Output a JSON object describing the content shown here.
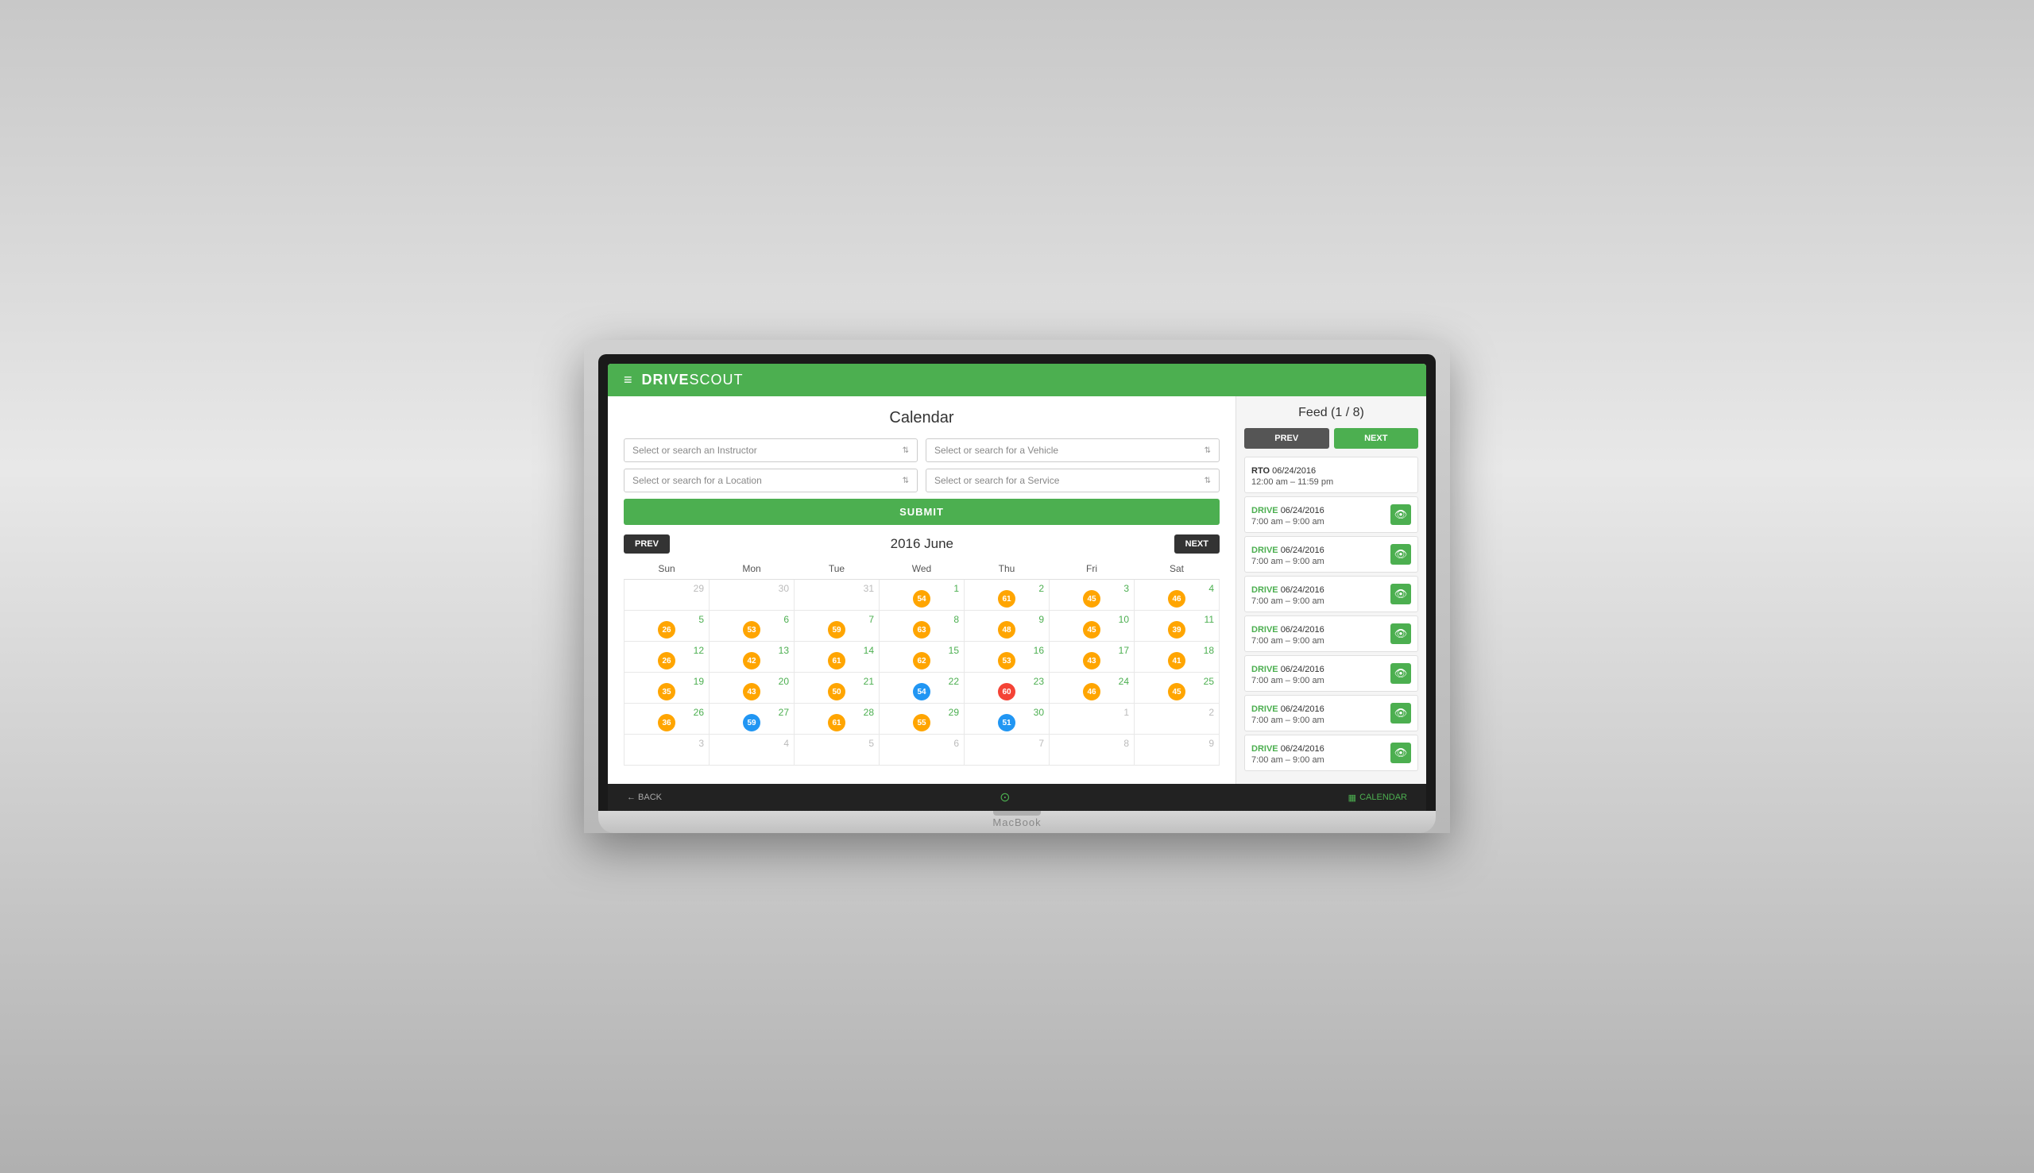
{
  "app": {
    "brand": "DRIVE",
    "brand_scout": "SCOUT",
    "laptop_brand": "MacBook"
  },
  "header": {
    "hamburger": "≡",
    "title": "Calendar",
    "feed_title": "Feed (1 / 8)"
  },
  "filters": {
    "instructor_placeholder": "Select or search an Instructor",
    "vehicle_placeholder": "Select or search for a Vehicle",
    "location_placeholder": "Select or search for a Location",
    "service_placeholder": "Select or search for a Service",
    "submit_label": "SUBMIT"
  },
  "calendar": {
    "prev_label": "PREV",
    "next_label": "NEXT",
    "month_title": "2016 June",
    "weekdays": [
      "Sun",
      "Mon",
      "Tue",
      "Wed",
      "Thu",
      "Fri",
      "Sat"
    ],
    "weeks": [
      [
        {
          "day": "29",
          "other": true,
          "badge": null
        },
        {
          "day": "30",
          "other": true,
          "badge": null
        },
        {
          "day": "31",
          "other": true,
          "badge": null
        },
        {
          "day": "1",
          "other": false,
          "badge": {
            "val": "54",
            "color": "yellow"
          }
        },
        {
          "day": "2",
          "other": false,
          "badge": {
            "val": "61",
            "color": "yellow"
          }
        },
        {
          "day": "3",
          "other": false,
          "badge": {
            "val": "45",
            "color": "yellow"
          }
        },
        {
          "day": "4",
          "other": false,
          "badge": {
            "val": "46",
            "color": "yellow"
          }
        }
      ],
      [
        {
          "day": "5",
          "other": false,
          "badge": {
            "val": "26",
            "color": "yellow"
          }
        },
        {
          "day": "6",
          "other": false,
          "badge": {
            "val": "53",
            "color": "yellow"
          }
        },
        {
          "day": "7",
          "other": false,
          "badge": {
            "val": "59",
            "color": "yellow"
          }
        },
        {
          "day": "8",
          "other": false,
          "badge": {
            "val": "63",
            "color": "yellow"
          }
        },
        {
          "day": "9",
          "other": false,
          "badge": {
            "val": "48",
            "color": "yellow"
          }
        },
        {
          "day": "10",
          "other": false,
          "badge": {
            "val": "45",
            "color": "yellow"
          }
        },
        {
          "day": "11",
          "other": false,
          "badge": {
            "val": "39",
            "color": "yellow"
          }
        }
      ],
      [
        {
          "day": "12",
          "other": false,
          "badge": {
            "val": "26",
            "color": "yellow"
          }
        },
        {
          "day": "13",
          "other": false,
          "badge": {
            "val": "42",
            "color": "yellow"
          }
        },
        {
          "day": "14",
          "other": false,
          "badge": {
            "val": "61",
            "color": "yellow"
          }
        },
        {
          "day": "15",
          "other": false,
          "badge": {
            "val": "62",
            "color": "yellow"
          }
        },
        {
          "day": "16",
          "other": false,
          "badge": {
            "val": "53",
            "color": "yellow"
          }
        },
        {
          "day": "17",
          "other": false,
          "badge": {
            "val": "43",
            "color": "yellow"
          }
        },
        {
          "day": "18",
          "other": false,
          "badge": {
            "val": "41",
            "color": "yellow"
          }
        }
      ],
      [
        {
          "day": "19",
          "other": false,
          "badge": {
            "val": "35",
            "color": "yellow"
          }
        },
        {
          "day": "20",
          "other": false,
          "badge": {
            "val": "43",
            "color": "yellow"
          }
        },
        {
          "day": "21",
          "other": false,
          "badge": {
            "val": "50",
            "color": "yellow"
          }
        },
        {
          "day": "22",
          "other": false,
          "badge": {
            "val": "54",
            "color": "blue"
          }
        },
        {
          "day": "23",
          "other": false,
          "badge": {
            "val": "60",
            "color": "red"
          }
        },
        {
          "day": "24",
          "other": false,
          "badge": {
            "val": "46",
            "color": "yellow"
          }
        },
        {
          "day": "25",
          "other": false,
          "badge": {
            "val": "45",
            "color": "yellow"
          }
        }
      ],
      [
        {
          "day": "26",
          "other": false,
          "badge": {
            "val": "36",
            "color": "yellow"
          }
        },
        {
          "day": "27",
          "other": false,
          "badge": {
            "val": "59",
            "color": "blue"
          }
        },
        {
          "day": "28",
          "other": false,
          "badge": {
            "val": "61",
            "color": "yellow"
          }
        },
        {
          "day": "29",
          "other": false,
          "badge": {
            "val": "55",
            "color": "yellow"
          }
        },
        {
          "day": "30",
          "other": false,
          "badge": {
            "val": "51",
            "color": "blue"
          }
        },
        {
          "day": "1",
          "other": true,
          "badge": null
        },
        {
          "day": "2",
          "other": true,
          "badge": null
        }
      ],
      [
        {
          "day": "3",
          "other": true,
          "badge": null
        },
        {
          "day": "4",
          "other": true,
          "badge": null
        },
        {
          "day": "5",
          "other": true,
          "badge": null
        },
        {
          "day": "6",
          "other": true,
          "badge": null
        },
        {
          "day": "7",
          "other": true,
          "badge": null
        },
        {
          "day": "8",
          "other": true,
          "badge": null
        },
        {
          "day": "9",
          "other": true,
          "badge": null
        }
      ]
    ]
  },
  "feed": {
    "title": "Feed (1 / 8)",
    "prev_label": "PREV",
    "next_label": "NEXT",
    "items": [
      {
        "type": "RTO",
        "type_class": "rto",
        "date": "06/24/2016",
        "time": "12:00 am – 11:59 pm",
        "has_eye": false
      },
      {
        "type": "DRIVE",
        "type_class": "drive",
        "date": "06/24/2016",
        "time": "7:00 am – 9:00 am",
        "has_eye": true
      },
      {
        "type": "DRIVE",
        "type_class": "drive",
        "date": "06/24/2016",
        "time": "7:00 am – 9:00 am",
        "has_eye": true
      },
      {
        "type": "DRIVE",
        "type_class": "drive",
        "date": "06/24/2016",
        "time": "7:00 am – 9:00 am",
        "has_eye": true
      },
      {
        "type": "DRIVE",
        "type_class": "drive",
        "date": "06/24/2016",
        "time": "7:00 am – 9:00 am",
        "has_eye": true
      },
      {
        "type": "DRIVE",
        "type_class": "drive",
        "date": "06/24/2016",
        "time": "7:00 am – 9:00 am",
        "has_eye": true
      },
      {
        "type": "DRIVE",
        "type_class": "drive",
        "date": "06/24/2016",
        "time": "7:00 am – 9:00 am",
        "has_eye": true
      },
      {
        "type": "DRIVE",
        "type_class": "drive",
        "date": "06/24/2016",
        "time": "7:00 am – 9:00 am",
        "has_eye": true
      }
    ]
  },
  "bottom_bar": {
    "back_label": "← BACK",
    "calendar_label": "CALENDAR"
  },
  "colors": {
    "green": "#4CAF50",
    "dark": "#333",
    "yellow_badge": "#FFA500",
    "blue_badge": "#2196F3",
    "red_badge": "#f44336"
  }
}
